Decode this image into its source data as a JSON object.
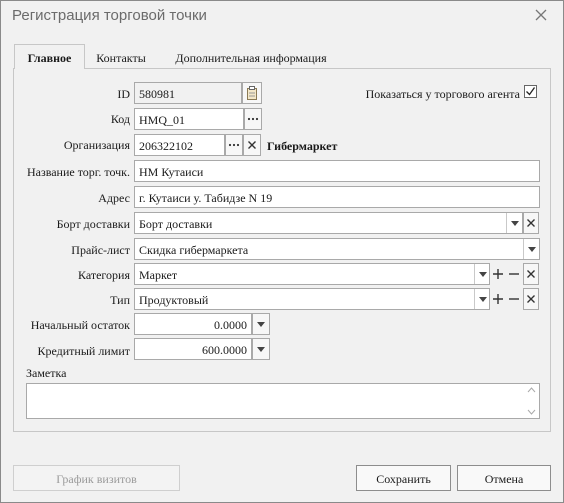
{
  "window": {
    "title": "Регистрация торговой точки"
  },
  "tabs": [
    "Главное",
    "Контакты",
    "Дополнительная информация"
  ],
  "form": {
    "id": {
      "label": "ID",
      "value": "580981"
    },
    "show_agent": {
      "label": "Показаться у торгового агента",
      "checked": true
    },
    "code": {
      "label": "Код",
      "value": "HMQ_01"
    },
    "org": {
      "label": "Организация",
      "value": "206322102",
      "name": "Гибермаркет"
    },
    "name": {
      "label": "Название торг. точк.",
      "value": "НМ  Кутаиси"
    },
    "address": {
      "label": "Адрес",
      "value": "г. Кутаиси у. Табидзе  N 19"
    },
    "delivery": {
      "label": "Борт доставки",
      "value": "Борт доставки"
    },
    "pricelist": {
      "label": "Прайс-лист",
      "value": "Скидка гибермаркета"
    },
    "category": {
      "label": "Категория",
      "value": "Маркет"
    },
    "type": {
      "label": "Тип",
      "value": "Продуктовый"
    },
    "opening_balance": {
      "label": "Начальный остаток",
      "value": "0.0000"
    },
    "credit_limit": {
      "label": "Кредитный лимит",
      "value": "600.0000"
    },
    "note": {
      "label": "Заметка",
      "value": ""
    }
  },
  "buttons": {
    "visits": "График визитов",
    "save": "Сохранить",
    "cancel": "Отмена"
  }
}
